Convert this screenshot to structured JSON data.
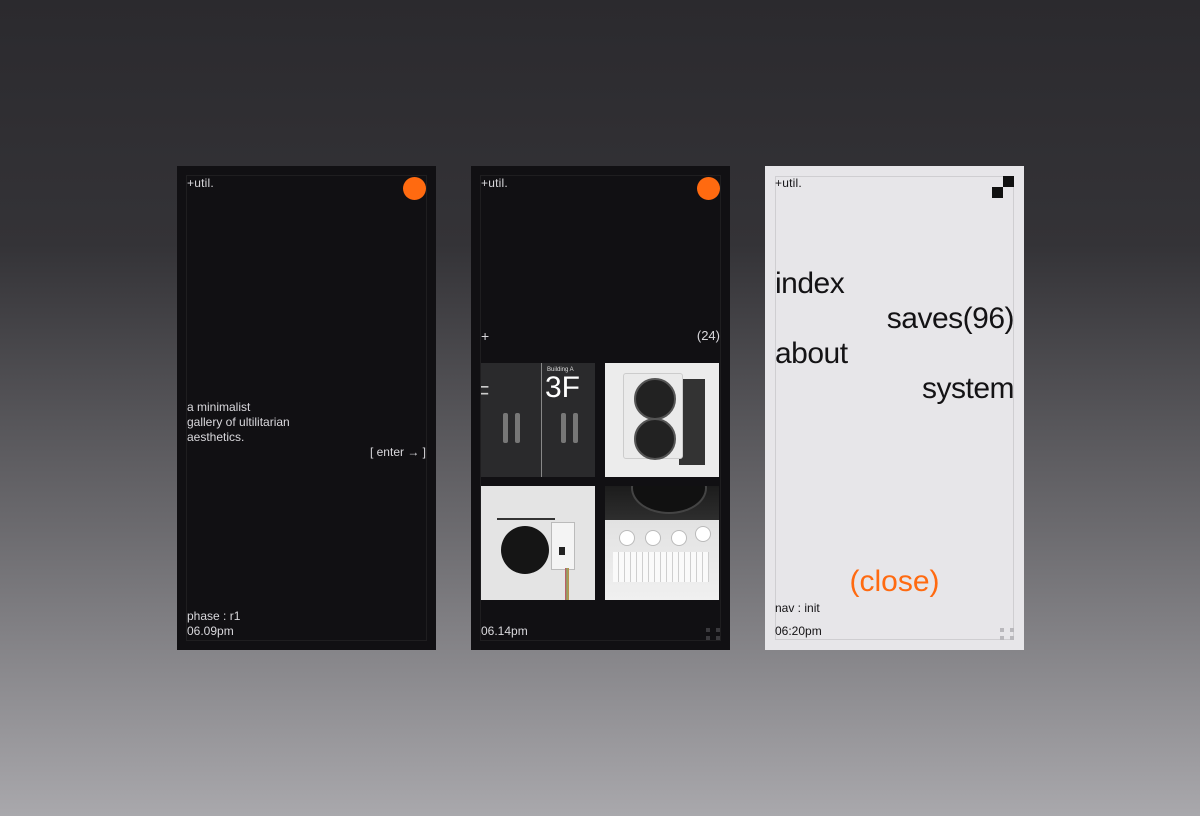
{
  "brand": "+util.",
  "accent_color": "#ff6a10",
  "screens": {
    "landing": {
      "tagline": [
        "a minimalist",
        "gallery of ultilitarian",
        "aesthetics."
      ],
      "enter_label": "[ enter → ]",
      "phase": "phase : r1",
      "time": "06.09pm"
    },
    "gallery": {
      "plus": "+",
      "count": "(24)",
      "time": "06.14pm",
      "thumb1": {
        "label": "Building A",
        "big": "3F",
        "big2": "F"
      }
    },
    "menu": {
      "items": [
        "index",
        "saves(96)",
        "about",
        "system"
      ],
      "close_label": "(close)",
      "nav_status": "nav : init",
      "time": "06:20pm"
    }
  }
}
